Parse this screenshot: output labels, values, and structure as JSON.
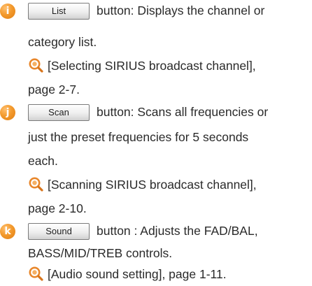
{
  "items": [
    {
      "badge": "i",
      "button_label": "List",
      "line1": "button: Displays the channel or",
      "line2": "category list.",
      "ref": "[Selecting SIRIUS broadcast channel],",
      "ref_page": "page 2-7."
    },
    {
      "badge": "j",
      "button_label": "Scan",
      "line1": "button: Scans all frequencies or",
      "line2": "just the preset frequencies for 5 seconds",
      "line3": "each.",
      "ref": "[Scanning SIRIUS broadcast channel],",
      "ref_page": "page 2-10."
    },
    {
      "badge": "k",
      "button_label": "Sound",
      "line1": "button : Adjusts the FAD/BAL,",
      "line2": "BASS/MID/TREB controls.",
      "ref": "[Audio sound setting], page 1-11."
    }
  ],
  "icons": {
    "badge": "letter-badge-icon",
    "reference": "magnifier-reference-icon"
  },
  "colors": {
    "badge": "#f39a2d",
    "reference_icon": "#e8862a",
    "text": "#2a2a2a",
    "button_border": "#7a7a7a"
  }
}
